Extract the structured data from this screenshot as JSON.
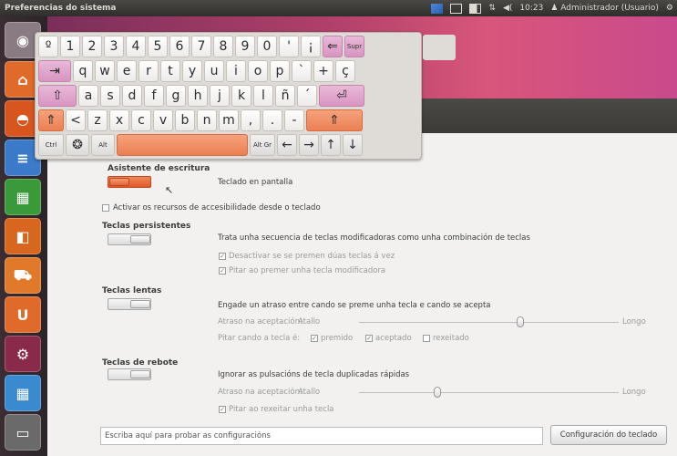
{
  "topbar": {
    "title": "Preferencias do sistema",
    "time": "10:23",
    "user": "Administrador (Usuario)",
    "volume": "◀(",
    "arrows": "⇅"
  },
  "launcher": {
    "items": [
      {
        "name": "dash-button",
        "glyph": "◉",
        "color": "#8a7a82"
      },
      {
        "name": "home-folder",
        "glyph": "⌂",
        "color": "#e06a2a"
      },
      {
        "name": "firefox",
        "glyph": "◓",
        "color": "#d8561e"
      },
      {
        "name": "writer",
        "glyph": "≡",
        "color": "#3a7ac8"
      },
      {
        "name": "calc",
        "glyph": "▦",
        "color": "#3a9a3a"
      },
      {
        "name": "impress",
        "glyph": "◧",
        "color": "#d8661e"
      },
      {
        "name": "software-center",
        "glyph": "⛟",
        "color": "#e07a2a"
      },
      {
        "name": "ubuntu-one",
        "glyph": "U",
        "color": "#e06a2a"
      },
      {
        "name": "system-settings",
        "glyph": "⚙",
        "color": "#8a2a4a"
      },
      {
        "name": "workspaces",
        "glyph": "▦",
        "color": "#3a8ad0"
      },
      {
        "name": "keyboard-app",
        "glyph": "▭",
        "color": "#6a6a6a"
      }
    ]
  },
  "keyboard": {
    "row1": [
      {
        "label": "º",
        "style": "white"
      },
      {
        "label": "1",
        "style": "white"
      },
      {
        "label": "2",
        "style": "white"
      },
      {
        "label": "3",
        "style": "white"
      },
      {
        "label": "4",
        "style": "white"
      },
      {
        "label": "5",
        "style": "white"
      },
      {
        "label": "6",
        "style": "white"
      },
      {
        "label": "7",
        "style": "white"
      },
      {
        "label": "8",
        "style": "white"
      },
      {
        "label": "9",
        "style": "white"
      },
      {
        "label": "0",
        "style": "white"
      },
      {
        "label": "'",
        "style": "white"
      },
      {
        "label": "¡",
        "style": "white"
      },
      {
        "label": "⇐",
        "style": "pink"
      },
      {
        "label": "Supr",
        "style": "pink"
      }
    ],
    "row2": [
      {
        "label": "⇥",
        "style": "pink"
      },
      {
        "label": "q",
        "style": "white"
      },
      {
        "label": "w",
        "style": "white"
      },
      {
        "label": "e",
        "style": "white"
      },
      {
        "label": "r",
        "style": "white"
      },
      {
        "label": "t",
        "style": "white"
      },
      {
        "label": "y",
        "style": "white"
      },
      {
        "label": "u",
        "style": "white"
      },
      {
        "label": "i",
        "style": "white"
      },
      {
        "label": "o",
        "style": "white"
      },
      {
        "label": "p",
        "style": "white"
      },
      {
        "label": "`",
        "style": "white"
      },
      {
        "label": "+",
        "style": "white"
      },
      {
        "label": "ç",
        "style": "white"
      }
    ],
    "row3": [
      {
        "label": "⇧",
        "style": "pink"
      },
      {
        "label": "a",
        "style": "white"
      },
      {
        "label": "s",
        "style": "white"
      },
      {
        "label": "d",
        "style": "white"
      },
      {
        "label": "f",
        "style": "white"
      },
      {
        "label": "g",
        "style": "white"
      },
      {
        "label": "h",
        "style": "white"
      },
      {
        "label": "j",
        "style": "white"
      },
      {
        "label": "k",
        "style": "white"
      },
      {
        "label": "l",
        "style": "white"
      },
      {
        "label": "ñ",
        "style": "white"
      },
      {
        "label": "´",
        "style": "white"
      },
      {
        "label": "⏎",
        "style": "pink"
      }
    ],
    "row4": [
      {
        "label": "⇑",
        "style": "orange"
      },
      {
        "label": "<",
        "style": "white"
      },
      {
        "label": "z",
        "style": "white"
      },
      {
        "label": "x",
        "style": "white"
      },
      {
        "label": "c",
        "style": "white"
      },
      {
        "label": "v",
        "style": "white"
      },
      {
        "label": "b",
        "style": "white"
      },
      {
        "label": "n",
        "style": "white"
      },
      {
        "label": "m",
        "style": "white"
      },
      {
        "label": ",",
        "style": "white"
      },
      {
        "label": ".",
        "style": "white"
      },
      {
        "label": "-",
        "style": "white"
      },
      {
        "label": "⇑",
        "style": "orange"
      }
    ],
    "row5": [
      {
        "label": "Ctrl",
        "style": "gray"
      },
      {
        "label": "❂",
        "style": "gray"
      },
      {
        "label": "Alt",
        "style": "gray"
      },
      {
        "label": "",
        "style": "orange"
      },
      {
        "label": "Alt Gr",
        "style": "gray"
      },
      {
        "label": "←",
        "style": "gray"
      },
      {
        "label": "→",
        "style": "gray"
      },
      {
        "label": "↑",
        "style": "gray"
      },
      {
        "label": "↓",
        "style": "gray"
      }
    ]
  },
  "settings": {
    "typing_assistant": {
      "title": "Asistente de escritura",
      "toggle_on": true,
      "label": "Teclado en pantalla"
    },
    "activate_access": "Activar os recursos de accesibilidade desde o teclado",
    "sticky_keys": {
      "title": "Teclas persistentes",
      "toggle_on": false,
      "description": "Trata unha secuencia de teclas modificadoras como unha combinación de teclas",
      "opt1": "Desactivar se se premen dúas teclas á vez",
      "opt2": "Pitar ao premer unha tecla modificadora"
    },
    "slow_keys": {
      "title": "Teclas lentas",
      "toggle_on": false,
      "description": "Engade un atraso entre cando se preme unha tecla e cando se acepta",
      "delay_label": "Atraso na aceptación:",
      "short": "Atallo",
      "long": "Longo",
      "delay_value": 0.62,
      "beep_label": "Pitar cando a tecla é:",
      "beep_pressed": "premido",
      "beep_accepted": "aceptado",
      "beep_rejected": "rexeitado"
    },
    "bounce_keys": {
      "title": "Teclas de rebote",
      "toggle_on": false,
      "description": "Ignorar as pulsacións de tecla duplicadas rápidas",
      "delay_label": "Atraso na aceptación:",
      "short": "Atallo",
      "long": "Longo",
      "delay_value": 0.3,
      "beep_reject": "Pitar ao rexeitar unha tecla"
    },
    "test_placeholder": "Escriba aquí para probar as configuracións",
    "keyboard_settings_button": "Configuración do teclado"
  },
  "colors": {
    "accent_orange": "#e05a2a",
    "accent_pink": "#d895c2"
  }
}
